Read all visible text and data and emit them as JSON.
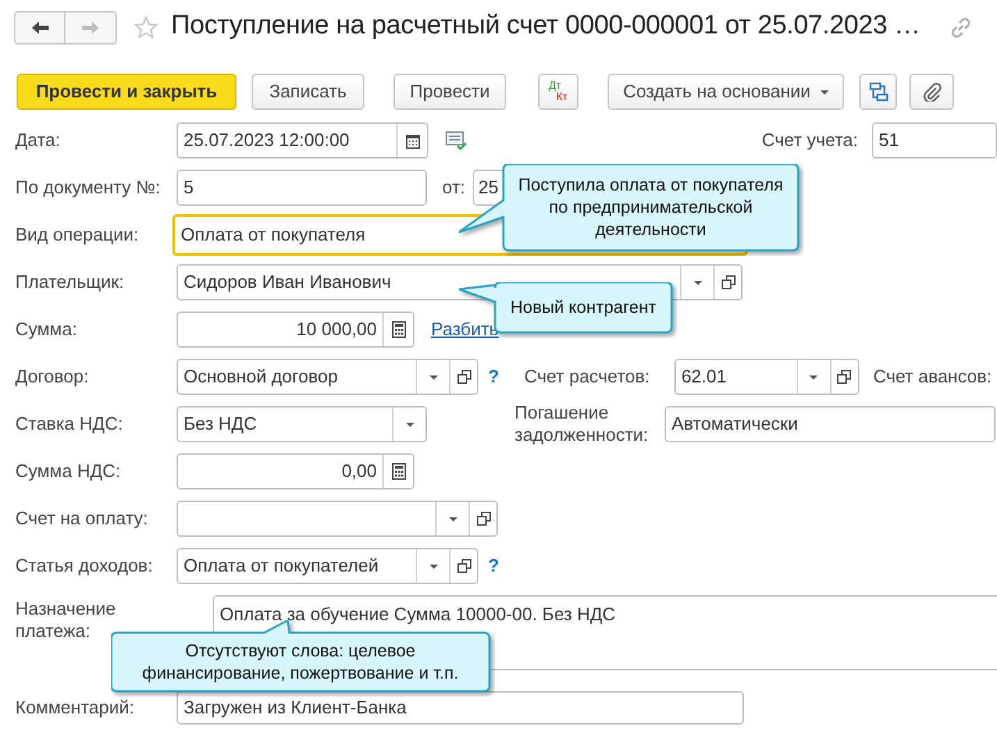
{
  "window": {
    "title": "Поступление на расчетный счет 0000-000001 от 25.07.2023 …"
  },
  "toolbar": [
    {
      "kind": "primary",
      "label": "Провести и закрыть"
    },
    {
      "kind": "plain",
      "label": "Записать"
    },
    {
      "kind": "plain",
      "label": "Провести"
    },
    {
      "kind": "dtkt",
      "debit": "Дт",
      "credit": "Кт"
    },
    {
      "kind": "menu",
      "label": "Создать на основании"
    },
    {
      "kind": "structure"
    },
    {
      "kind": "attach"
    }
  ],
  "form": {
    "date": {
      "label": "Дата:",
      "value": "25.07.2023 12:00:00"
    },
    "account": {
      "label": "Счет учета:",
      "value": "51"
    },
    "doc_number": {
      "label": "По документу №:",
      "value": "5"
    },
    "doc_date": {
      "label": "от:",
      "value": "25"
    },
    "operation": {
      "label": "Вид операции:",
      "value": "Оплата от покупателя",
      "focused": true
    },
    "payer": {
      "label": "Плательщик:",
      "value": "Сидоров Иван Иванович"
    },
    "amount": {
      "label": "Сумма:",
      "value": "10 000,00"
    },
    "split_link": "Разбить",
    "contract": {
      "label": "Договор:",
      "value": "Основной договор",
      "help": "?"
    },
    "settlement_account": {
      "label": "Счет расчетов:",
      "value": "62.01"
    },
    "advance_account": {
      "label": "Счет авансов:"
    },
    "vat_rate": {
      "label": "Ставка НДС:",
      "value": "Без НДС"
    },
    "repayment": {
      "label": "Погашение задолженности:",
      "value": "Автоматически"
    },
    "vat_amount": {
      "label": "Сумма НДС:",
      "value": "0,00"
    },
    "invoice": {
      "label": "Счет на оплату:"
    },
    "income_item": {
      "label": "Статья доходов:",
      "value": "Оплата от покупателей",
      "help": "?"
    },
    "purpose": {
      "label": "Назначение платежа:",
      "value": "Оплата за обучение Сумма 10000-00. Без НДС"
    },
    "comment": {
      "label": "Комментарий:",
      "value": "Загружен из Клиент-Банка"
    }
  },
  "callouts": [
    {
      "text": "Поступила оплата от покупателя по предпринимательской деятельности"
    },
    {
      "text": "Новый контрагент"
    },
    {
      "text": "Отсутствуют слова: целевое финансирование, пожертвование и т.п."
    }
  ]
}
